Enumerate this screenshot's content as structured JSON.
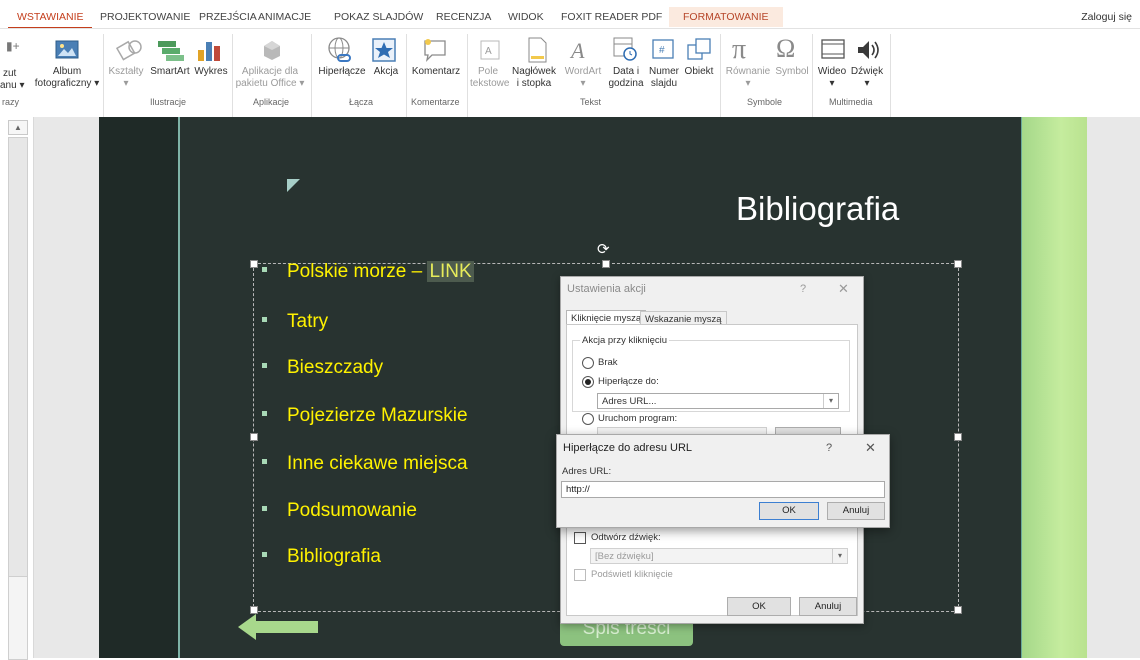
{
  "ribbon": {
    "tabs": [
      "WSTAWIANIE",
      "PROJEKTOWANIE",
      "PRZEJŚCIA",
      "ANIMACJE",
      "POKAZ SLAJDÓW",
      "RECENZJA",
      "WIDOK",
      "FOXIT READER PDF",
      "FORMATOWANIE"
    ],
    "signin": "Zaloguj się",
    "buttons": {
      "zut": "zut",
      "anu": "anu",
      "album1": "Album",
      "album2": "fotograficzny",
      "ksztalty": "Kształty",
      "smartart": "SmartArt",
      "wykres": "Wykres",
      "aplikacje1": "Aplikacje dla",
      "aplikacje2": "pakietu Office",
      "hiperlacze": "Hiperłącze",
      "akcja": "Akcja",
      "komentarz": "Komentarz",
      "pole1": "Pole",
      "pole2": "tekstowe",
      "naglowek1": "Nagłówek",
      "naglowek2": "i stopka",
      "wordart": "WordArt",
      "data1": "Data i",
      "data2": "godzina",
      "numer1": "Numer",
      "numer2": "slajdu",
      "obiekt": "Obiekt",
      "rownanie": "Równanie",
      "symbol": "Symbol",
      "wideo": "Wideo",
      "dzwiek": "Dźwięk"
    },
    "groups": {
      "obrazy": "razy",
      "ilustracje": "Ilustracje",
      "aplikacje": "Aplikacje",
      "lacza": "Łącza",
      "komentarze": "Komentarze",
      "tekst": "Tekst",
      "symbole": "Symbole",
      "multimedia": "Multimedia"
    }
  },
  "slide": {
    "title": "Bibliografia",
    "bullets": [
      "Polskie morze – ",
      "Tatry",
      "Bieszczady",
      "Pojezierze Mazurskie",
      "Inne ciekawe miejsca",
      "Podsumowanie",
      "Bibliografia"
    ],
    "link_text": "LINK",
    "nav_button": "Spis treści"
  },
  "action_dialog": {
    "title": "Ustawienia akcji",
    "help": "?",
    "close": "✕",
    "tab_click": "Kliknięcie myszą",
    "tab_hover": "Wskazanie myszą",
    "group_label": "Akcja przy kliknięciu",
    "opt_none": "Brak",
    "opt_hyperlink": "Hiperłącze do:",
    "hyperlink_value": "Adres URL...",
    "opt_run": "Uruchom program:",
    "play_sound": "Odtwórz dźwięk:",
    "sound_value": "[Bez dźwięku]",
    "highlight": "Podświetl kliknięcie",
    "ok": "OK",
    "cancel": "Anuluj"
  },
  "url_dialog": {
    "title": "Hiperłącze do adresu URL",
    "help": "?",
    "close": "✕",
    "label": "Adres URL:",
    "value": "http://",
    "ok": "OK",
    "cancel": "Anuluj"
  },
  "colors": {
    "accent": "#c43e1c",
    "slide_bg": "#283330",
    "bullet_text": "#fff200",
    "green_button": "#8cc27f"
  }
}
